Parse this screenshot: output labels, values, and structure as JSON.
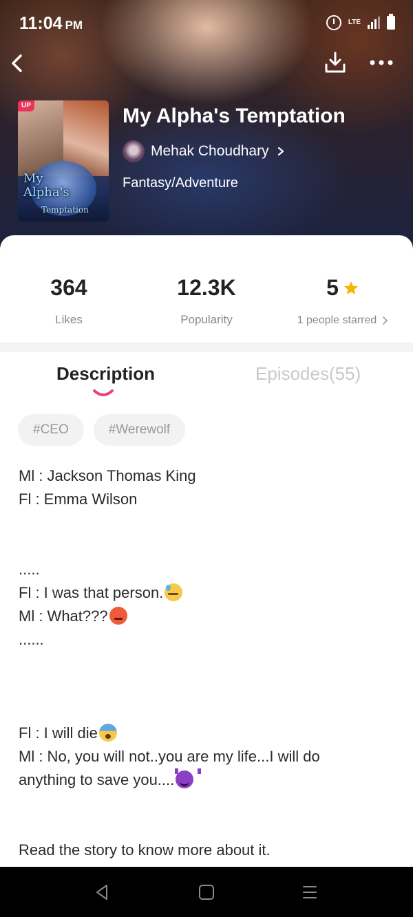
{
  "status_bar": {
    "time": "11:04",
    "ampm": "PM",
    "network": "LTE"
  },
  "book": {
    "title": "My Alpha's Temptation",
    "author": "Mehak Choudhary",
    "genre": "Fantasy/Adventure",
    "badge": "UP",
    "cover_title_line1": "My",
    "cover_title_line2": "Alpha's",
    "cover_subtitle": "Temptation"
  },
  "stats": {
    "likes_value": "364",
    "likes_label": "Likes",
    "popularity_value": "12.3K",
    "popularity_label": "Popularity",
    "rating_value": "5",
    "rating_label": "1 people starred"
  },
  "tabs": {
    "description": "Description",
    "episodes": "Episodes(55)"
  },
  "tags": [
    "#CEO",
    "#Werewolf"
  ],
  "description": {
    "l1": "Ml : Jackson Thomas King",
    "l2": "Fl : Emma Wilson",
    "l3": ".....",
    "l4": "Fl : I was that person.",
    "l5": "Ml : What???",
    "l6": "......",
    "l7": "Fl : I will die",
    "l8": "Ml : No, you will not..you are my life...I will do",
    "l9": "anything to save you....",
    "l10": "Read the story to know more about it."
  },
  "colors": {
    "accent": "#e9457a",
    "star": "#f7b500",
    "badge": "#e9355a"
  }
}
